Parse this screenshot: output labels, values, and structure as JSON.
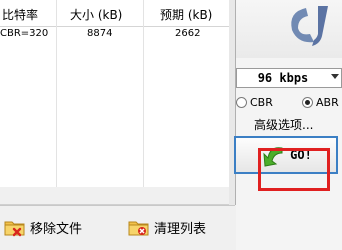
{
  "list": {
    "columns": [
      "比特率",
      "大小 (kB)",
      "预期 (kB)"
    ],
    "rows": [
      {
        "bitrate": "CBR=320",
        "size": "8874",
        "expected": "2662"
      }
    ]
  },
  "actions": {
    "remove_label": "移除文件",
    "clear_label": "清理列表"
  },
  "settings": {
    "bitrate_value": "96 kbps",
    "cbr_label": "CBR",
    "abr_label": "ABR",
    "selected_mode": "ABR",
    "advanced_label": "高级选项...",
    "go_label": "GO!"
  },
  "colors": {
    "go_border": "#3b7fc4",
    "highlight": "#e02020",
    "arrow": "#4cae2b"
  }
}
